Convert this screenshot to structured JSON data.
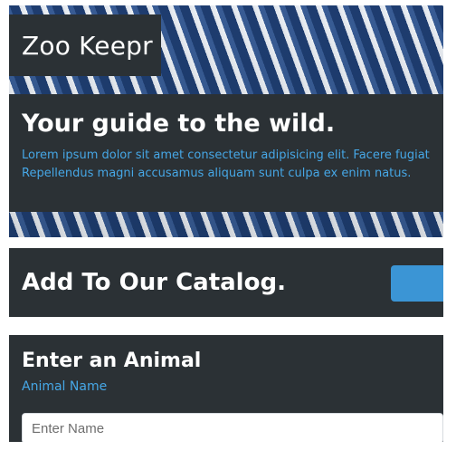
{
  "app": {
    "brand": "Zoo Keepr"
  },
  "hero": {
    "title": "Your guide to the wild.",
    "body_line_1": "Lorem ipsum dolor sit amet consectetur adipisicing elit. Facere fugiat",
    "body_line_2": "Repellendus magni accusamus aliquam sunt culpa ex enim natus."
  },
  "catalog": {
    "title": "Add To Our Catalog."
  },
  "form": {
    "title": "Enter an Animal",
    "name_label": "Animal Name",
    "name_placeholder": "Enter Name",
    "name_value": ""
  },
  "colors": {
    "panel": "#2b3135",
    "accent": "#3b95d5",
    "text_accent": "#46a7e6"
  }
}
